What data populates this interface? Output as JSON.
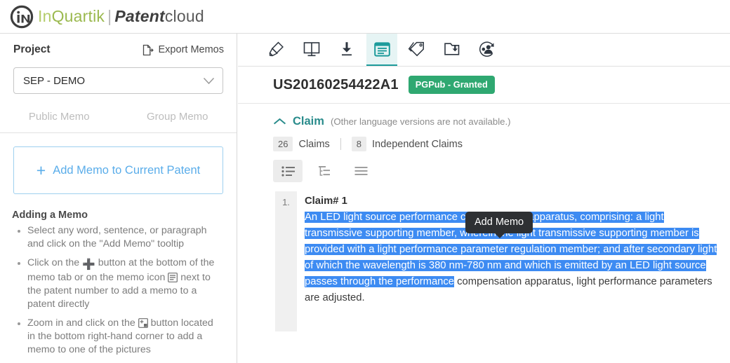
{
  "brand": {
    "logo_icon": "inquartik-circle-logo",
    "name_in": "In",
    "name_q": "Quartik",
    "divider": "|",
    "product_bold": "Patent",
    "product_light": "cloud",
    "accent_green": "#b4cc6a",
    "accent_teal": "#1d9b9b"
  },
  "sidebar": {
    "title": "Project",
    "export": {
      "label": "Export Memos",
      "icon": "export-document-icon"
    },
    "project_select": {
      "value": "SEP - DEMO",
      "icon": "chevron-down-icon"
    },
    "memo_tabs": [
      {
        "label": "Public Memo",
        "active": false
      },
      {
        "label": "Group Memo",
        "active": false
      }
    ],
    "add_memo_button": {
      "plus": "+",
      "label": "Add Memo to Current Patent",
      "color": "#5aadea"
    },
    "help": {
      "title": "Adding a Memo",
      "items": [
        {
          "a": "Select any word, sentence, or paragraph and click on the \"Add Memo\" tooltip",
          "b": "",
          "c": "",
          "icon": ""
        },
        {
          "a": "Click on the ",
          "icon": "plus-icon",
          "b": " button at the bottom of the memo tab or on the memo icon ",
          "icon2": "memo-icon",
          "c": " next to the patent number to add a memo to a patent directly"
        },
        {
          "a": "Zoom in and click on the ",
          "icon": "add-picture-memo-icon",
          "b": " button located in the bottom right-hand corner to add a memo to one of the pictures",
          "c": ""
        }
      ]
    }
  },
  "main": {
    "toolbar": [
      {
        "name": "highlighter-icon",
        "active": false
      },
      {
        "name": "compare-pages-icon",
        "active": false
      },
      {
        "name": "download-icon",
        "active": false
      },
      {
        "name": "memo-icon",
        "active": true
      },
      {
        "name": "tag-icon",
        "active": false
      },
      {
        "name": "export-folder-icon",
        "active": false
      },
      {
        "name": "share-user-icon",
        "active": false
      }
    ],
    "patent": {
      "number": "US20160254422A1",
      "status_badge": "PGPub - Granted",
      "badge_color": "#2fa871"
    },
    "claim_section": {
      "collapse_icon": "chevron-up-icon",
      "title": "Claim",
      "note": "(Other language versions are not available.)",
      "counts": {
        "claims_number": "26",
        "claims_label": "Claims",
        "independent_number": "8",
        "independent_label": "Independent Claims"
      },
      "view_modes": [
        {
          "name": "list-view-icon",
          "active": true
        },
        {
          "name": "tree-view-icon",
          "active": false
        },
        {
          "name": "plain-view-icon",
          "active": false
        }
      ]
    },
    "claim": {
      "index": "1.",
      "heading": "Claim# 1",
      "highlighted_text": "An LED light source performance compensation apparatus, comprising: a light transmissive supporting member, wherein the light transmissive supporting member is provided with a light performance parameter regulation member; and after secondary light of which the wavelength is 380 nm-780 nm and which is emitted by an LED light source passes through the performance",
      "trailing_text": " compensation apparatus, light performance parameters are adjusted.",
      "highlight_color": "#3d8bf2"
    },
    "tooltip": {
      "label": "Add Memo"
    }
  }
}
